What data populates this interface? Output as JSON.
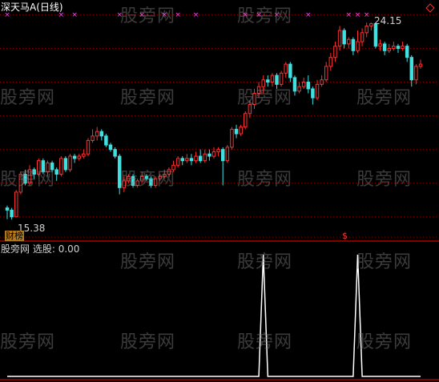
{
  "title": {
    "stock": "深天马A",
    "period": "(日线)"
  },
  "colors": {
    "background": "#000000",
    "up": "#ff3030",
    "down": "#40e0e0",
    "signal": "#ff40ff",
    "indicator_line": "#ffffff",
    "grid": "#8b0000",
    "divider": "#ff0000"
  },
  "price_panel": {
    "max_label": "24.15",
    "min_label": "15.38",
    "bottom_badge": "财榜",
    "marker_symbol": "$",
    "grid_levels": [
      24.5,
      23,
      21.5,
      20,
      18.5,
      17,
      15.5,
      14.6
    ],
    "ylim": [
      14.6,
      24.8
    ]
  },
  "indicator_panel": {
    "name": "股旁网 选股",
    "value_label": "0.00",
    "ylim": [
      0,
      1
    ]
  },
  "watermark_text": "股旁网",
  "chart_data": {
    "type": "candlestick",
    "candles": [
      [
        15.9,
        15.8,
        16.0,
        15.4
      ],
      [
        15.8,
        15.5,
        15.9,
        15.38
      ],
      [
        15.5,
        16.6,
        16.7,
        15.5
      ],
      [
        16.6,
        17.4,
        17.5,
        16.5
      ],
      [
        17.4,
        17.0,
        17.6,
        16.9
      ],
      [
        17.0,
        17.6,
        17.8,
        16.9
      ],
      [
        17.6,
        17.4,
        17.7,
        17.2
      ],
      [
        17.4,
        18.0,
        18.1,
        17.3
      ],
      [
        18.0,
        17.5,
        18.1,
        17.4
      ],
      [
        17.5,
        17.9,
        18.0,
        17.3
      ],
      [
        17.9,
        17.6,
        18.0,
        17.5
      ],
      [
        17.6,
        17.4,
        17.7,
        17.1
      ],
      [
        17.4,
        18.1,
        18.2,
        17.3
      ],
      [
        18.1,
        17.6,
        18.2,
        17.5
      ],
      [
        17.6,
        18.2,
        18.3,
        17.5
      ],
      [
        18.2,
        18.1,
        18.3,
        17.9
      ],
      [
        18.1,
        18.2,
        18.3,
        18.0
      ],
      [
        18.2,
        18.3,
        18.5,
        18.1
      ],
      [
        18.3,
        18.9,
        19.0,
        18.2
      ],
      [
        18.9,
        19.1,
        19.4,
        18.8
      ],
      [
        19.1,
        19.3,
        19.5,
        18.9
      ],
      [
        19.3,
        19.1,
        19.4,
        18.9
      ],
      [
        19.1,
        18.7,
        19.2,
        18.6
      ],
      [
        18.7,
        18.5,
        18.8,
        18.4
      ],
      [
        18.5,
        18.2,
        18.6,
        18.1
      ],
      [
        18.2,
        16.8,
        18.3,
        16.5
      ],
      [
        16.8,
        17.1,
        17.3,
        16.6
      ],
      [
        17.1,
        17.3,
        17.4,
        17.0
      ],
      [
        17.3,
        16.9,
        17.4,
        16.8
      ],
      [
        16.9,
        17.1,
        17.2,
        16.8
      ],
      [
        17.1,
        17.3,
        17.5,
        17.0
      ],
      [
        17.3,
        17.2,
        17.4,
        17.1
      ],
      [
        17.2,
        16.9,
        17.3,
        16.8
      ],
      [
        16.9,
        17.2,
        17.3,
        16.8
      ],
      [
        17.2,
        17.3,
        17.4,
        17.1
      ],
      [
        17.3,
        17.4,
        17.6,
        17.2
      ],
      [
        17.4,
        17.6,
        17.7,
        17.3
      ],
      [
        17.6,
        17.8,
        18.0,
        17.5
      ],
      [
        17.8,
        18.1,
        18.2,
        17.7
      ],
      [
        18.1,
        18.0,
        18.2,
        17.8
      ],
      [
        18.0,
        18.1,
        18.3,
        17.9
      ],
      [
        18.1,
        18.0,
        18.3,
        17.8
      ],
      [
        18.0,
        18.2,
        18.4,
        17.9
      ],
      [
        18.2,
        18.0,
        18.5,
        17.9
      ],
      [
        18.0,
        18.3,
        18.5,
        17.9
      ],
      [
        18.3,
        18.2,
        18.5,
        18.0
      ],
      [
        18.2,
        18.4,
        18.6,
        18.1
      ],
      [
        18.4,
        18.5,
        18.6,
        18.2
      ],
      [
        18.5,
        18.0,
        18.6,
        16.9
      ],
      [
        18.0,
        18.6,
        18.7,
        17.9
      ],
      [
        18.6,
        19.4,
        19.5,
        18.5
      ],
      [
        19.4,
        19.2,
        19.6,
        19.0
      ],
      [
        19.2,
        19.5,
        19.6,
        19.1
      ],
      [
        19.5,
        20.1,
        20.2,
        19.4
      ],
      [
        20.1,
        20.5,
        20.7,
        19.9
      ],
      [
        20.5,
        21.0,
        21.2,
        20.3
      ],
      [
        21.0,
        21.3,
        21.5,
        20.8
      ],
      [
        21.3,
        21.6,
        21.8,
        21.0
      ],
      [
        21.6,
        21.5,
        21.8,
        21.3
      ],
      [
        21.5,
        21.8,
        21.9,
        21.3
      ],
      [
        21.8,
        21.4,
        21.9,
        21.2
      ],
      [
        21.4,
        21.9,
        22.0,
        21.3
      ],
      [
        21.9,
        22.3,
        22.4,
        21.7
      ],
      [
        22.3,
        21.7,
        22.4,
        21.5
      ],
      [
        21.7,
        21.1,
        21.8,
        20.9
      ],
      [
        21.1,
        21.3,
        21.5,
        21.0
      ],
      [
        21.3,
        21.5,
        21.7,
        21.2
      ],
      [
        21.5,
        21.2,
        21.8,
        21.0
      ],
      [
        21.2,
        20.8,
        21.3,
        20.5
      ],
      [
        20.8,
        21.4,
        21.6,
        20.7
      ],
      [
        21.4,
        21.6,
        21.8,
        21.3
      ],
      [
        21.6,
        22.2,
        22.4,
        21.5
      ],
      [
        22.2,
        22.6,
        22.8,
        22.0
      ],
      [
        22.6,
        23.1,
        23.3,
        22.4
      ],
      [
        23.1,
        23.8,
        24.0,
        22.9
      ],
      [
        23.8,
        23.2,
        23.9,
        23.0
      ],
      [
        23.2,
        23.4,
        23.5,
        23.0
      ],
      [
        23.4,
        22.9,
        23.5,
        22.7
      ],
      [
        22.9,
        23.3,
        23.8,
        22.8
      ],
      [
        23.3,
        23.7,
        23.9,
        23.1
      ],
      [
        23.7,
        24.0,
        24.15,
        23.5
      ],
      [
        24.0,
        24.1,
        24.15,
        23.8
      ],
      [
        24.1,
        23.1,
        24.15,
        23.0
      ],
      [
        23.1,
        23.2,
        23.4,
        22.9
      ],
      [
        23.2,
        22.9,
        23.3,
        22.7
      ],
      [
        22.9,
        23.0,
        23.2,
        22.8
      ],
      [
        23.0,
        23.1,
        23.3,
        22.9
      ],
      [
        23.1,
        23.0,
        23.2,
        22.8
      ],
      [
        23.0,
        23.1,
        23.3,
        22.9
      ],
      [
        23.1,
        22.6,
        23.2,
        22.4
      ],
      [
        22.6,
        21.6,
        22.7,
        21.3
      ],
      [
        21.6,
        22.2,
        22.3,
        21.4
      ],
      [
        22.2,
        22.3,
        22.5,
        22.1
      ]
    ],
    "signals_top_row_indices": [
      0,
      12,
      15,
      25,
      30,
      35,
      38,
      42,
      53,
      56,
      60,
      67,
      76,
      78,
      80
    ],
    "indicator_values": [
      0,
      0,
      0,
      0,
      0,
      0,
      0,
      0,
      0,
      0,
      0,
      0,
      0,
      0,
      0,
      0,
      0,
      0,
      0,
      0,
      0,
      0,
      0,
      0,
      0,
      0,
      0,
      0,
      0,
      0,
      0,
      0,
      0,
      0,
      0,
      0,
      0,
      0,
      0,
      0,
      0,
      0,
      0,
      0,
      0,
      0,
      0,
      0,
      0,
      0,
      0,
      0,
      0,
      0,
      0,
      0,
      0,
      1,
      0,
      0,
      0,
      0,
      0,
      0,
      0,
      0,
      0,
      0,
      0,
      0,
      0,
      0,
      0,
      0,
      0,
      0,
      0,
      0,
      1,
      0,
      0,
      0,
      0,
      0,
      0,
      0,
      0,
      0,
      0,
      0,
      0,
      0,
      0
    ],
    "ylim": [
      14.6,
      24.8
    ]
  }
}
